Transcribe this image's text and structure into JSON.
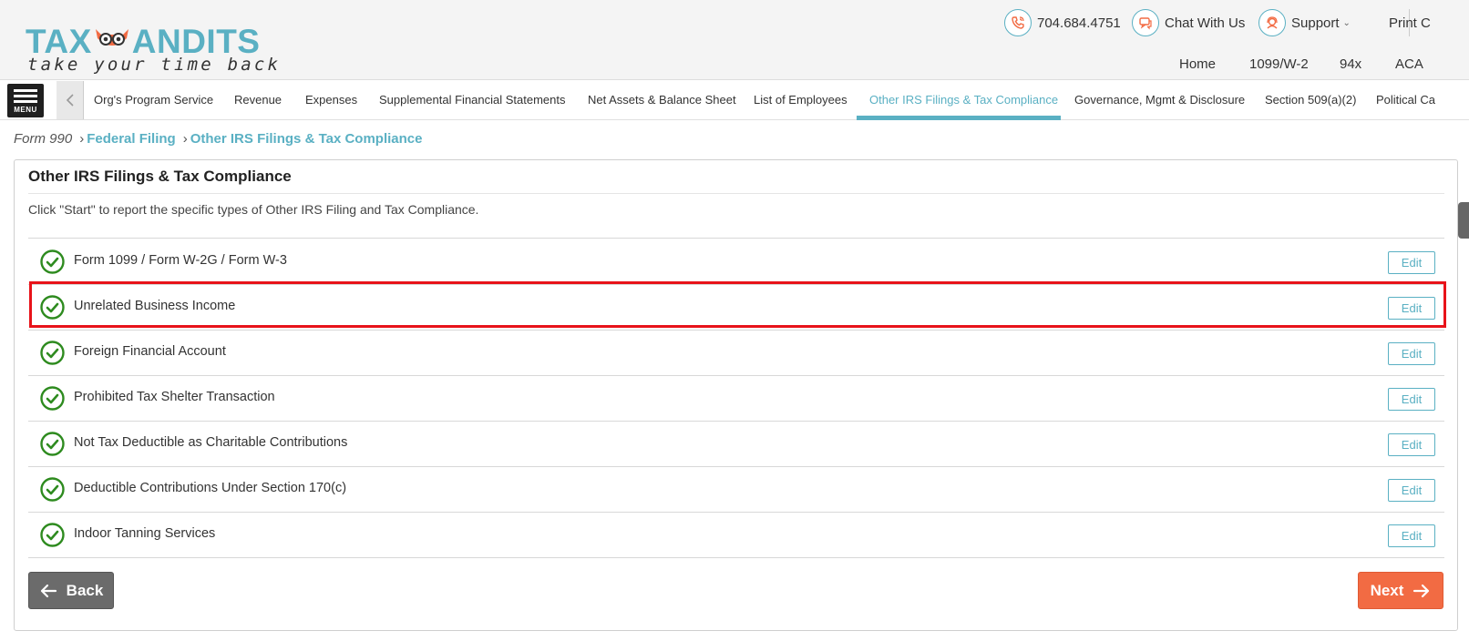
{
  "brand": {
    "logo_left": "TAX",
    "logo_right": "ANDITS",
    "tagline": "take your time back",
    "accent": "#5ab0c3",
    "orange": "#f26b43"
  },
  "header": {
    "phone": "704.684.4751",
    "chat": "Chat With Us",
    "support": "Support",
    "print": "Print C",
    "nav": [
      "Home",
      "1099/W-2",
      "94x",
      "ACA"
    ]
  },
  "tabs": [
    "Org's Program Service",
    "Revenue",
    "Expenses",
    "Supplemental Financial Statements",
    "Net Assets & Balance Sheet",
    "List of Employees",
    "Other IRS Filings & Tax Compliance",
    "Governance, Mgmt & Disclosure",
    "Section 509(a)(2)",
    "Political Ca"
  ],
  "menu_label": "MENU",
  "breadcrumb": {
    "root": "Form 990",
    "level1": "Federal Filing",
    "level2": "Other IRS Filings & Tax Compliance"
  },
  "card": {
    "title": "Other IRS Filings & Tax Compliance",
    "description": "Click \"Start\" to report the specific types of Other IRS Filing and Tax Compliance.",
    "edit_label": "Edit",
    "items": [
      "Form 1099 / Form W-2G / Form W-3",
      "Unrelated Business Income",
      "Foreign Financial Account",
      "Prohibited Tax Shelter Transaction",
      "Not Tax Deductible as Charitable Contributions",
      "Deductible Contributions Under Section 170(c)",
      "Indoor Tanning Services"
    ]
  },
  "buttons": {
    "back": "Back",
    "next": "Next"
  }
}
